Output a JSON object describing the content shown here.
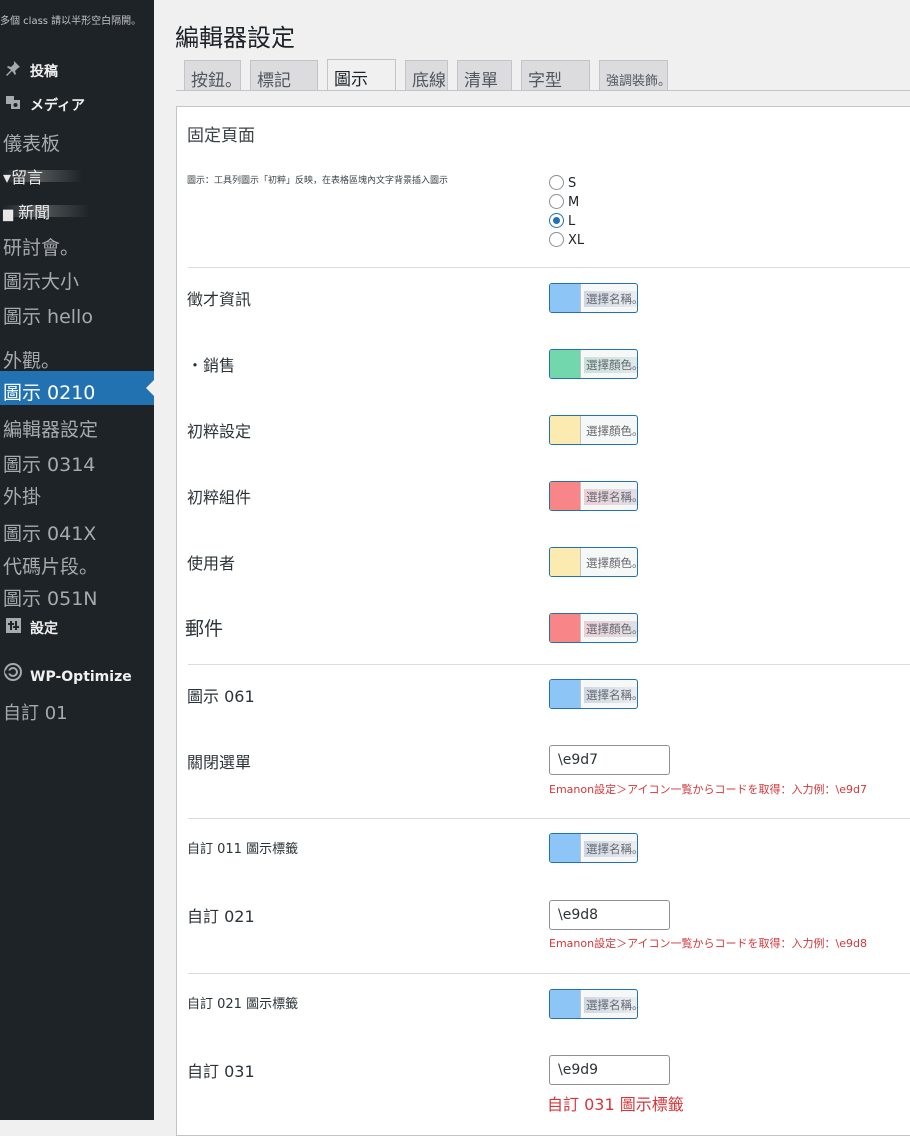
{
  "sidebar": {
    "note": "多個 class 請以半形空白隔開。",
    "items": [
      {
        "label": "投稿",
        "icon": "pin-icon"
      },
      {
        "label": "メディア",
        "icon": "media-icon"
      },
      {
        "label": "儀表板"
      },
      {
        "label": "留言"
      },
      {
        "label": "新聞"
      },
      {
        "label": "研討會。"
      },
      {
        "label": "圖示大小"
      },
      {
        "label": "圖示 hello"
      },
      {
        "label": "外觀。"
      },
      {
        "label": "圖示 0210"
      },
      {
        "label": "編輯器設定"
      },
      {
        "label": "圖示 0314"
      },
      {
        "label": "外掛"
      },
      {
        "label": "圖示 041X"
      },
      {
        "label": "代碼片段。"
      },
      {
        "label": "圖示 051N"
      },
      {
        "label": "設定",
        "icon": "settings-icon"
      },
      {
        "label": "WP-Optimize",
        "icon": "wp-optimize-icon"
      },
      {
        "label": "自訂 01"
      }
    ]
  },
  "page": {
    "title": "編輯器設定"
  },
  "tabs": [
    "按鈕。",
    "標記",
    "圖示",
    "底線",
    "清單",
    "字型",
    "強調裝飾。"
  ],
  "active_tab": "圖示",
  "section": {
    "title": "固定頁面"
  },
  "radio": {
    "label": "圖示：工具列圖示「初粹」反映，在表格區塊內文字背景插入圖示",
    "options": [
      "S",
      "M",
      "L",
      "XL"
    ],
    "selected": "L"
  },
  "colors": {
    "blue": "#8ec5f7",
    "green": "#72d7ad",
    "yellow": "#fcebb0",
    "red": "#f88588",
    "accent": "#2271b1",
    "hint": "#d63638"
  },
  "rows": [
    {
      "label": "徵才資訊",
      "picker": "選擇名稱。"
    },
    {
      "label": "・銷售",
      "picker": "選擇顏色。"
    },
    {
      "label": "初粹設定",
      "picker": "選擇顏色。"
    },
    {
      "label": "初粹組件",
      "picker": "選擇名稱。"
    },
    {
      "label": "使用者",
      "picker": "選擇顏色。"
    },
    {
      "label": "郵件",
      "picker": "選擇顏色。"
    },
    {
      "label": "圖示 061",
      "picker": "選擇名稱。"
    },
    {
      "label": "關閉選單",
      "value": "\\e9d7",
      "hint": "Emanon設定＞アイコン一覧からコードを取得：入力例：\\e9d7"
    },
    {
      "label": "自訂 011 圖示標籤",
      "picker": "選擇名稱。"
    },
    {
      "label": "自訂 021",
      "value": "\\e9d8",
      "hint": "Emanon設定＞アイコン一覧からコードを取得：入力例：\\e9d8"
    },
    {
      "label": "自訂 021 圖示標籤",
      "picker": "選擇名稱。"
    },
    {
      "label": "自訂 031",
      "value": "\\e9d9",
      "hint": "自訂 031 圖示標籤"
    }
  ]
}
